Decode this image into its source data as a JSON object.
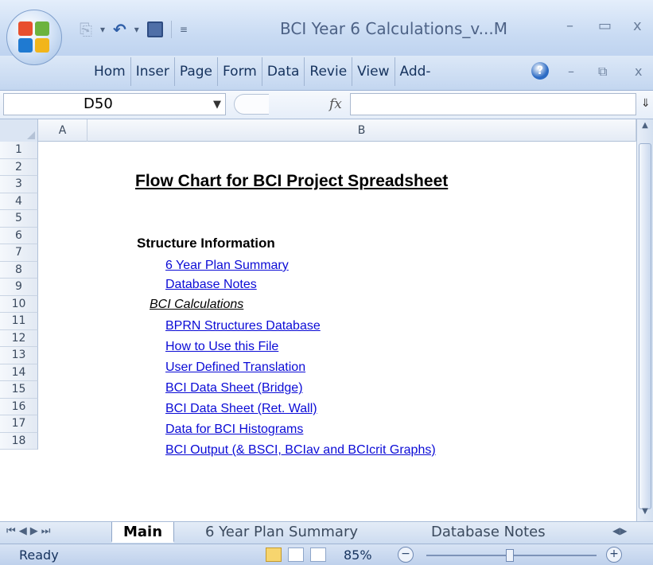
{
  "window": {
    "title": "BCI Year 6 Calculations_v...M",
    "min_glyph": "–",
    "max_glyph": "▭",
    "close_glyph": "x"
  },
  "ribbon": {
    "tabs": [
      "Hom",
      "Inser",
      "Page",
      "Form",
      "Data",
      "Revie",
      "View",
      "Add-"
    ]
  },
  "formula_bar": {
    "name_box": "D50",
    "fx": "fx",
    "value": ""
  },
  "columns": [
    "A",
    "B"
  ],
  "rows": [
    "1",
    "2",
    "3",
    "4",
    "5",
    "6",
    "7",
    "8",
    "9",
    "10",
    "11",
    "12",
    "13",
    "14",
    "15",
    "16",
    "17",
    "18"
  ],
  "sheet": {
    "heading": "Flow Chart for BCI Project Spreadsheet",
    "section": "Structure Information",
    "links_group1": [
      "6 Year Plan Summary",
      "Database Notes"
    ],
    "subheading": "BCI Calculations",
    "links_group2": [
      "BPRN Structures Database",
      "How to Use this File",
      "User Defined Translation",
      "BCI Data Sheet (Bridge)",
      "BCI Data Sheet (Ret. Wall)",
      "Data for BCI Histograms",
      "BCI Output (& BSCI, BCIav and BCIcrit Graphs)"
    ]
  },
  "sheet_tabs": [
    "Main",
    "6 Year Plan Summary",
    "Database Notes"
  ],
  "status": {
    "text": "Ready",
    "zoom": "85%"
  },
  "colors": {
    "link": "#0b0bd6",
    "ribbon_bg": "#c9dbf3"
  }
}
